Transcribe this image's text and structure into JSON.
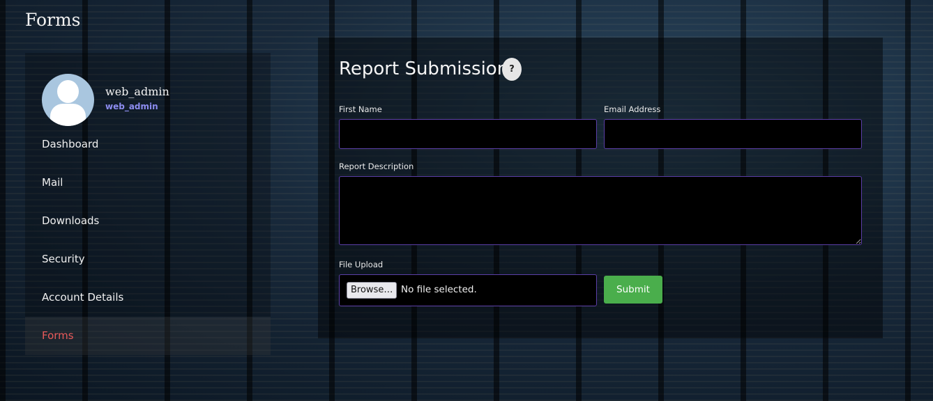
{
  "page": {
    "title": "Forms"
  },
  "profile": {
    "name": "web_admin",
    "handle": "web_admin"
  },
  "sidebar": {
    "items": [
      {
        "label": "Dashboard",
        "active": false
      },
      {
        "label": "Mail",
        "active": false
      },
      {
        "label": "Downloads",
        "active": false
      },
      {
        "label": "Security",
        "active": false
      },
      {
        "label": "Account Details",
        "active": false
      },
      {
        "label": "Forms",
        "active": true
      }
    ]
  },
  "form": {
    "title": "Report Submission",
    "help_label": "?",
    "first_name": {
      "label": "First Name",
      "value": ""
    },
    "email": {
      "label": "Email Address",
      "value": ""
    },
    "description": {
      "label": "Report Description",
      "value": ""
    },
    "file_upload": {
      "label": "File Upload",
      "browse_label": "Browse…",
      "status": "No file selected."
    },
    "submit_label": "Submit"
  },
  "colors": {
    "active_nav": "#e85a5a",
    "handle": "#8c8cf0",
    "field_border": "#5c3fa8",
    "submit": "#4aae4c"
  }
}
